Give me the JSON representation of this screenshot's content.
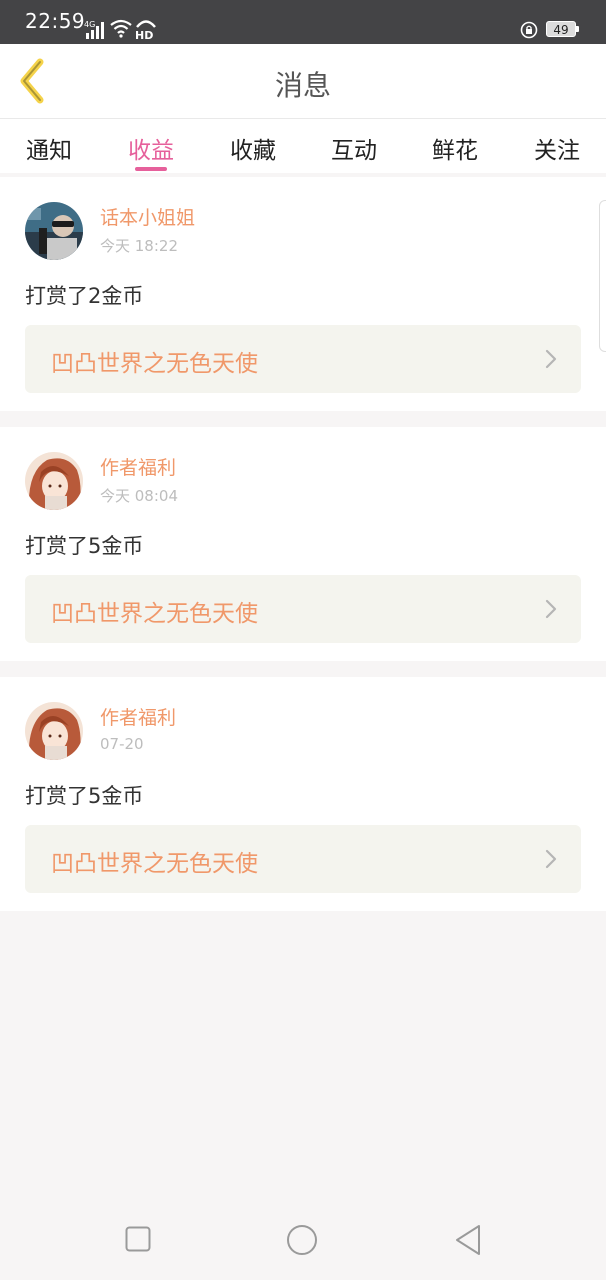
{
  "status_bar": {
    "time": "22:59",
    "network": "4G",
    "hd": "HD",
    "battery": "49"
  },
  "header": {
    "title": "消息",
    "back_icon": "chevron-left-icon",
    "accent_color": "#e6609b"
  },
  "tabs": [
    {
      "label": "通知",
      "active": false
    },
    {
      "label": "收益",
      "active": true
    },
    {
      "label": "收藏",
      "active": false
    },
    {
      "label": "互动",
      "active": false
    },
    {
      "label": "鲜花",
      "active": false
    },
    {
      "label": "关注",
      "active": false
    }
  ],
  "messages": [
    {
      "sender": "话本小姐姐",
      "time": "今天 18:22",
      "action": "打赏了2金币",
      "book": "凹凸世界之无色天使"
    },
    {
      "sender": "作者福利",
      "time": "今天 08:04",
      "action": "打赏了5金币",
      "book": "凹凸世界之无色天使"
    },
    {
      "sender": "作者福利",
      "time": "07-20",
      "action": "打赏了5金币",
      "book": "凹凸世界之无色天使"
    }
  ],
  "colors": {
    "name_color": "#f0986a",
    "book_bg": "#f4f4ee"
  }
}
